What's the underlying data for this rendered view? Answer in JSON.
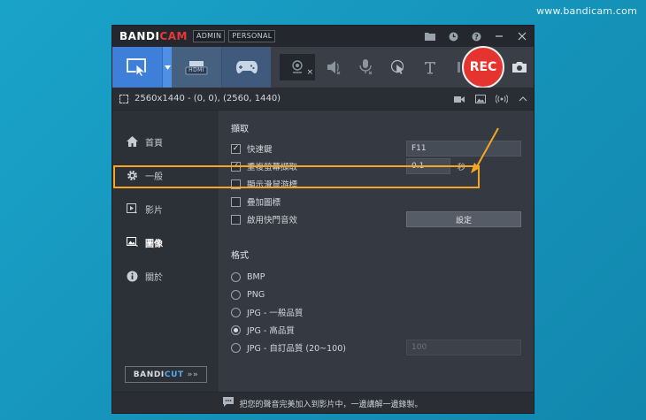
{
  "watermark": "www.bandicam.com",
  "titlebar": {
    "logo_main": "BANDI",
    "logo_accent": "CAM",
    "chip_admin": "ADMIN",
    "chip_personal": "PERSONAL"
  },
  "toolbar": {
    "hdmi_label": "HDMI",
    "rec_label": "REC"
  },
  "statusbar": {
    "resolution": "2560x1440 - (0, 0), (2560, 1440)"
  },
  "sidebar": {
    "items": [
      {
        "label": "首頁",
        "icon": "home-icon"
      },
      {
        "label": "一般",
        "icon": "gear-icon"
      },
      {
        "label": "影片",
        "icon": "video-icon"
      },
      {
        "label": "圖像",
        "icon": "image-icon",
        "active": true
      },
      {
        "label": "關於",
        "icon": "info-icon"
      }
    ],
    "bandicut_main": "BANDI",
    "bandicut_accent": "CUT",
    "bandicut_arrows": "»»"
  },
  "capture": {
    "section_title": "擷取",
    "hotkey_label": "快速鍵",
    "hotkey_value": "F11",
    "repeat_label": "重複螢幕擷取",
    "repeat_value": "0.1",
    "repeat_unit": "秒",
    "cursor_label": "顯示滑鼠游標",
    "logo_label": "疊加圖標",
    "shutter_label": "啟用快門音效",
    "settings_button": "設定"
  },
  "format": {
    "section_title": "格式",
    "options": [
      "BMP",
      "PNG",
      "JPG - 一般品質",
      "JPG - 高品質",
      "JPG - 自訂品質 (20~100)"
    ],
    "selected_index": 3,
    "custom_quality_value": "100"
  },
  "footer": {
    "message": "把您的聲音完美加入到影片中，一邊講解一邊錄製。"
  },
  "colors": {
    "accent": "#3d7fd9",
    "rec": "#e5332f",
    "highlight": "#f5a623"
  }
}
